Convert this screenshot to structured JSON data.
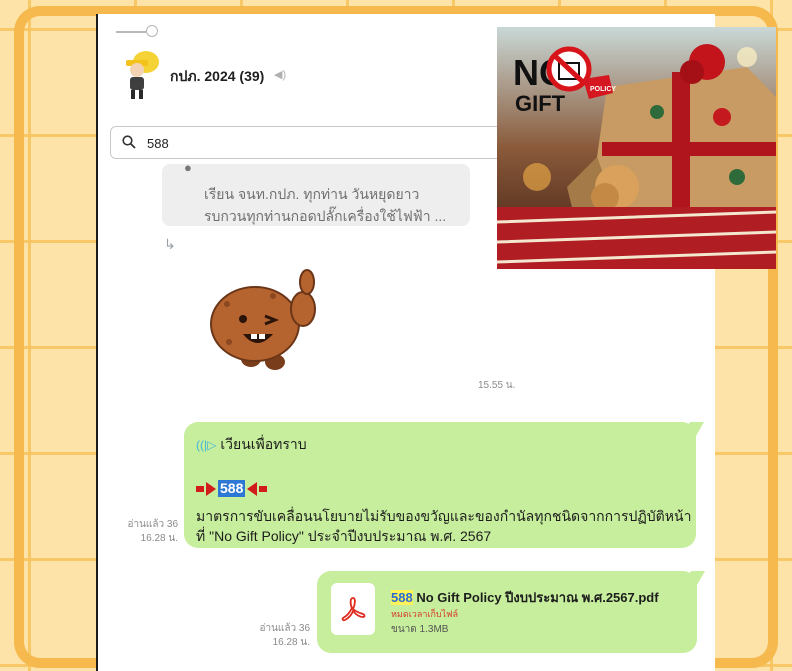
{
  "colors": {
    "bubble": "#c6ee9c",
    "background": "#fde3a8",
    "highlight_search": "#2d78d4",
    "highlight_file": "#fff35a",
    "arrow": "#d21c1c",
    "expired": "#d73b2a"
  },
  "header": {
    "group_title": "กปภ. 2024 (39)",
    "speaker_icon": "speaker-muted-icon"
  },
  "search": {
    "value": "588",
    "icon": "search-icon"
  },
  "reply": {
    "line1": "เรียน จนท.กปภ. ทุกท่าน วันหยุดยาว",
    "line2": "รบกวนทุกท่านกอดปลั๊กเครื่องใช้ไฟฟ้า  ..."
  },
  "sticker": {
    "time": "15.55 น."
  },
  "message1": {
    "announce": "เวียนเพื่อทราบ",
    "number": "588",
    "body_line1": "มาตรการขับเคลื่อนนโยบายไม่รับของขวัญและของกำนัลทุกชนิดจากการปฏิบัติหน้า",
    "body_line2": "ที่ \"No Gift Policy\" ประจำปีงบประมาณ พ.ศ. 2567",
    "read": "อ่านแล้ว 36",
    "time": "16.28 น."
  },
  "message2": {
    "file_number": "588",
    "file_name": "No Gift Policy  ปีงบประมาณ พ.ศ.2567.pdf",
    "expiry": "หมดเวลาเก็บไฟล์",
    "size": "ขนาด 1.3MB",
    "read": "อ่านแล้ว 36",
    "time": "16.28 น."
  },
  "image": {
    "no_text": "NO",
    "gift_text": "GIFT",
    "tag_text": "POLICY"
  }
}
